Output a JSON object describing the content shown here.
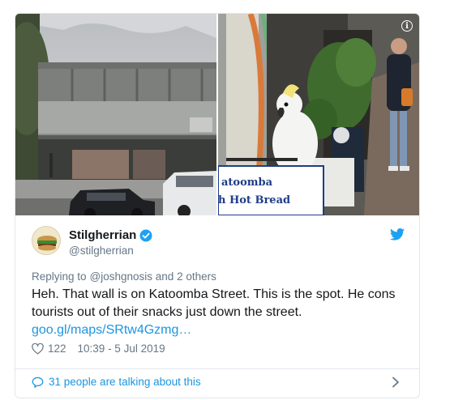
{
  "tweet": {
    "photos": [
      {
        "icon": "street-photo"
      },
      {
        "icon": "cockatoo-photo",
        "sign_text_1": "atoomba",
        "sign_text_2": "h Hot Bread"
      }
    ],
    "media_info_icon": "info-icon",
    "author": {
      "display_name": "Stilgherrian",
      "handle": "@stilgherrian",
      "verified_icon": "verified-badge-icon",
      "avatar": "avatar-icon"
    },
    "platform_icon": "twitter-bird-icon",
    "replying_to": {
      "prefix": "Replying to",
      "target": "@joshgnosis and 2 others"
    },
    "text": "Heh. That wall is on Katoomba Street. This is the spot. He cons tourists out of their snacks just down the street.",
    "link": "goo.gl/maps/SRtw4Gzmg…",
    "likes": "122",
    "timestamp": "10:39 - 5 Jul 2019",
    "talking": "31 people are talking about this"
  },
  "colors": {
    "accent": "#1b95e0",
    "secondary_text": "#657786",
    "border": "#e1e8ed",
    "twitter_blue": "#1da1f2"
  }
}
